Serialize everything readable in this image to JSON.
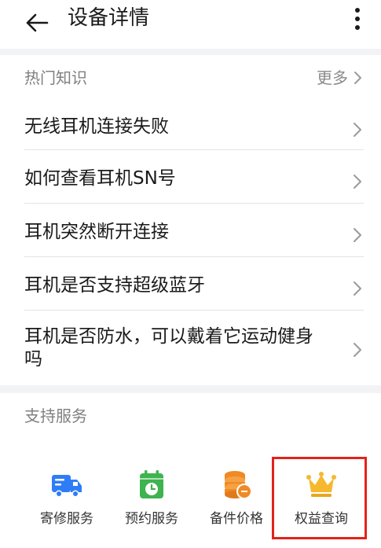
{
  "header": {
    "title": "设备详情",
    "back_icon": "arrow-left-icon",
    "more_icon": "more-vertical-icon"
  },
  "knowledge": {
    "section_title": "热门知识",
    "more_label": "更多",
    "items": [
      {
        "label": "无线耳机连接失败"
      },
      {
        "label": "如何查看耳机SN号"
      },
      {
        "label": "耳机突然断开连接"
      },
      {
        "label": "耳机是否支持超级蓝牙"
      },
      {
        "label": "耳机是否防水，可以戴着它运动健身吗"
      }
    ]
  },
  "services": {
    "section_title": "支持服务",
    "items": [
      {
        "label": "寄修服务",
        "icon": "delivery-truck-icon",
        "color": "#2f7df6"
      },
      {
        "label": "预约服务",
        "icon": "calendar-clock-icon",
        "color": "#3fb34f"
      },
      {
        "label": "备件价格",
        "icon": "coin-stack-icon",
        "color": "#f08a24"
      },
      {
        "label": "权益查询",
        "icon": "crown-icon",
        "color": "#f5b82e"
      }
    ],
    "highlight_color": "#e2231a"
  }
}
